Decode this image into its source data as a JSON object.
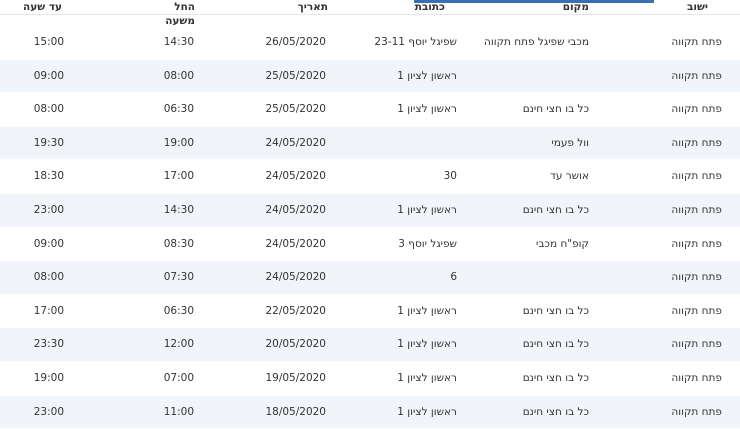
{
  "table": {
    "headers": {
      "settlement": "ישוב",
      "place": "מקום",
      "address": "כתובת",
      "date": "תאריך",
      "from_time": "החל משעה",
      "to_time": "עד שעה"
    },
    "rows": [
      {
        "settlement": "פתח תקווה",
        "place": "מכבי שפיגל פתח תקווה",
        "address": "שפיגל יוסף 23-11",
        "date": "26/05/2020",
        "from_time": "14:30",
        "to_time": "15:00"
      },
      {
        "settlement": "פתח תקווה",
        "place": "",
        "address": "ראשון לציון 1",
        "date": "25/05/2020",
        "from_time": "08:00",
        "to_time": "09:00"
      },
      {
        "settlement": "פתח תקווה",
        "place": "כל בו חצי חינם",
        "address": "ראשון לציון 1",
        "date": "25/05/2020",
        "from_time": "06:30",
        "to_time": "08:00"
      },
      {
        "settlement": "פתח תקווה",
        "place": "וול פעמי",
        "address": "",
        "date": "24/05/2020",
        "from_time": "19:00",
        "to_time": "19:30"
      },
      {
        "settlement": "פתח תקווה",
        "place": "אושר עד",
        "address": "30",
        "date": "24/05/2020",
        "from_time": "17:00",
        "to_time": "18:30"
      },
      {
        "settlement": "פתח תקווה",
        "place": "כל בו חצי חינם",
        "address": "ראשון לציון 1",
        "date": "24/05/2020",
        "from_time": "14:30",
        "to_time": "23:00"
      },
      {
        "settlement": "פתח תקווה",
        "place": "קופ\"ח מכבי",
        "address": "שפיגל יוסף 3",
        "date": "24/05/2020",
        "from_time": "08:30",
        "to_time": "09:00"
      },
      {
        "settlement": "פתח תקווה",
        "place": "",
        "address": "6",
        "date": "24/05/2020",
        "from_time": "07:30",
        "to_time": "08:00"
      },
      {
        "settlement": "פתח תקווה",
        "place": "כל בו חצי חינם",
        "address": "ראשון לציון 1",
        "date": "22/05/2020",
        "from_time": "06:30",
        "to_time": "17:00"
      },
      {
        "settlement": "פתח תקווה",
        "place": "כל בו חצי חינם",
        "address": "ראשון לציון 1",
        "date": "20/05/2020",
        "from_time": "12:00",
        "to_time": "23:30"
      },
      {
        "settlement": "פתח תקווה",
        "place": "כל בו חצי חינם",
        "address": "ראשון לציון 1",
        "date": "19/05/2020",
        "from_time": "07:00",
        "to_time": "19:00"
      },
      {
        "settlement": "פתח תקווה",
        "place": "כל בו חצי חינם",
        "address": "ראשון לציון 1",
        "date": "18/05/2020",
        "from_time": "11:00",
        "to_time": "23:00"
      }
    ]
  },
  "colors": {
    "accent": "#3a6fb0",
    "row_alt": "#f1f4f8",
    "text": "#333333"
  }
}
